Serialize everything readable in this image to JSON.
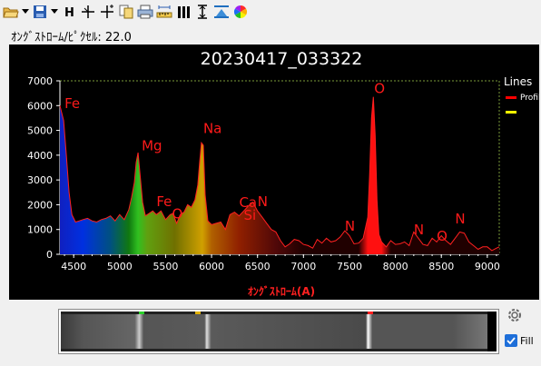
{
  "toolbar": {
    "icons": [
      "open-folder-icon",
      "dropdown-arrow-icon",
      "save-disk-icon",
      "dropdown-arrow-icon",
      "h-marker-icon",
      "crosshair-icon",
      "crosshair-plus-icon",
      "copy-icon",
      "print-icon",
      "ruler-icon",
      "bars-icon",
      "vertical-arrows-icon",
      "flip-icon",
      "color-wheel-icon"
    ]
  },
  "status": {
    "label": "ｵﾝｸﾞｽﾄﾛｰﾑ/ﾋﾟｸｾﾙ",
    "separator": ": ",
    "value": "22.0"
  },
  "chart_data": {
    "type": "area",
    "title": "20230417_033322",
    "xlabel": "ｵﾝｸﾞｽﾄﾛｰﾑ(A)",
    "ylabel": "",
    "xlim": [
      4350,
      9130
    ],
    "ylim": [
      0,
      7000
    ],
    "x_ticks": [
      "4500",
      "5000",
      "5500",
      "6000",
      "6500",
      "7000",
      "7500",
      "8000",
      "8500",
      "9000"
    ],
    "y_ticks": [
      "0",
      "1000",
      "2000",
      "3000",
      "4000",
      "5000",
      "6000",
      "7000"
    ],
    "legend": {
      "title": "Lines",
      "placement": "right",
      "entries": [
        {
          "label": "Profile",
          "color": "#ff0000"
        },
        {
          "label": "",
          "color": "#ffff00"
        }
      ]
    },
    "series": [
      {
        "name": "Profile",
        "x": [
          4350,
          4390,
          4420,
          4450,
          4480,
          4520,
          4560,
          4600,
          4650,
          4700,
          4750,
          4800,
          4850,
          4900,
          4950,
          5000,
          5050,
          5100,
          5130,
          5160,
          5180,
          5200,
          5220,
          5250,
          5280,
          5320,
          5360,
          5400,
          5450,
          5500,
          5550,
          5580,
          5620,
          5660,
          5700,
          5740,
          5780,
          5820,
          5850,
          5870,
          5890,
          5910,
          5930,
          5960,
          6000,
          6050,
          6100,
          6150,
          6200,
          6250,
          6300,
          6350,
          6400,
          6450,
          6500,
          6550,
          6600,
          6650,
          6700,
          6750,
          6800,
          6850,
          6900,
          6950,
          7000,
          7050,
          7100,
          7150,
          7200,
          7250,
          7300,
          7350,
          7400,
          7450,
          7500,
          7550,
          7600,
          7650,
          7700,
          7720,
          7740,
          7760,
          7780,
          7800,
          7820,
          7850,
          7900,
          7950,
          8000,
          8050,
          8100,
          8150,
          8200,
          8250,
          8300,
          8350,
          8400,
          8450,
          8500,
          8550,
          8600,
          8650,
          8700,
          8750,
          8800,
          8850,
          8900,
          8950,
          9000,
          9050,
          9100,
          9130
        ],
        "y": [
          6000,
          5400,
          4000,
          2500,
          1600,
          1300,
          1350,
          1400,
          1450,
          1350,
          1300,
          1400,
          1450,
          1550,
          1350,
          1600,
          1400,
          1800,
          2300,
          2900,
          3700,
          4100,
          3300,
          2100,
          1550,
          1650,
          1750,
          1600,
          1750,
          1400,
          1600,
          1650,
          1250,
          1600,
          1700,
          2000,
          1900,
          2200,
          2800,
          3700,
          4500,
          4400,
          2400,
          1350,
          1200,
          1250,
          1300,
          1000,
          1600,
          1700,
          1550,
          1750,
          1950,
          2100,
          1750,
          1500,
          1250,
          1000,
          900,
          550,
          300,
          420,
          600,
          550,
          400,
          350,
          250,
          600,
          450,
          650,
          500,
          550,
          700,
          950,
          750,
          420,
          450,
          650,
          1500,
          3200,
          5500,
          6350,
          4800,
          2200,
          800,
          500,
          300,
          550,
          400,
          420,
          500,
          350,
          900,
          650,
          400,
          350,
          650,
          500,
          750,
          550,
          400,
          650,
          900,
          850,
          500,
          350,
          200,
          300,
          300,
          150,
          250,
          300
        ]
      }
    ],
    "annotations": [
      {
        "label": "Fe",
        "x": 4400,
        "y": 5900
      },
      {
        "label": "Mg",
        "x": 5240,
        "y": 4200
      },
      {
        "label": "Fe",
        "x": 5400,
        "y": 1950
      },
      {
        "label": "O",
        "x": 5570,
        "y": 1450
      },
      {
        "label": "Na",
        "x": 5910,
        "y": 4900
      },
      {
        "label": "Ca",
        "x": 6300,
        "y": 1900
      },
      {
        "label": "Si",
        "x": 6350,
        "y": 1400
      },
      {
        "label": "N",
        "x": 6500,
        "y": 1950
      },
      {
        "label": "N",
        "x": 7450,
        "y": 950
      },
      {
        "label": "O",
        "x": 7770,
        "y": 6500
      },
      {
        "label": "N",
        "x": 8200,
        "y": 800
      },
      {
        "label": "O",
        "x": 8450,
        "y": 550
      },
      {
        "label": "N",
        "x": 8650,
        "y": 1250
      }
    ],
    "grid": false
  },
  "fill": {
    "label": "Fill",
    "checked": true
  }
}
